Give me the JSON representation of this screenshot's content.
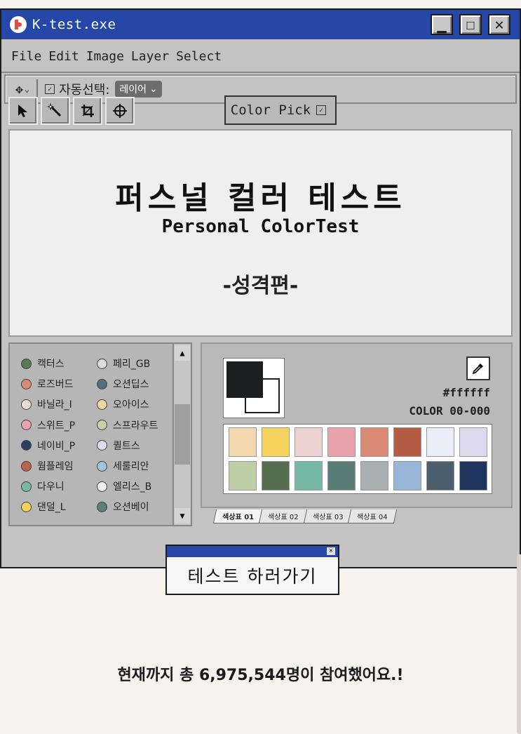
{
  "window": {
    "title": "K-test.exe",
    "controls": {
      "minimize": "▁",
      "maximize": "☐",
      "close": "✕"
    }
  },
  "menu": [
    "File",
    "Edit",
    "Image",
    "Layer",
    "Select"
  ],
  "options_bar": {
    "move_icon": "✥",
    "caret": "⌄",
    "auto_select_label": "자동선택:",
    "select_value": "레이어",
    "select_caret": "⌄"
  },
  "tools": [
    "arrow-tool",
    "magic-wand-tool",
    "crop-tool",
    "target-tool"
  ],
  "color_pick_label": "Color Pick",
  "canvas": {
    "title": "퍼스널 컬러 테스트",
    "subtitle": "Personal ColorTest",
    "edition": "-성격편-"
  },
  "types": [
    {
      "name": "캑터스",
      "color": "#5b7a52"
    },
    {
      "name": "로즈버드",
      "color": "#d98a72"
    },
    {
      "name": "바닐라_I",
      "color": "#f1dcd2"
    },
    {
      "name": "스위트_P",
      "color": "#e9a3ab"
    },
    {
      "name": "네이비_P",
      "color": "#2a3d66"
    },
    {
      "name": "웜플레임",
      "color": "#b9634d"
    },
    {
      "name": "다우니",
      "color": "#78b8a6"
    },
    {
      "name": "댄덜_L",
      "color": "#f4cf56"
    },
    {
      "name": "페리_GB",
      "color": "#dddddd"
    },
    {
      "name": "오션딥스",
      "color": "#556e7b"
    },
    {
      "name": "오아이스",
      "color": "#f3d6a2"
    },
    {
      "name": "스프라우트",
      "color": "#c2d4a4"
    },
    {
      "name": "퀼트스",
      "color": "#e0dcf0"
    },
    {
      "name": "세룰리안",
      "color": "#a6c3de"
    },
    {
      "name": "엘리스_B",
      "color": "#eef0f7"
    },
    {
      "name": "오션베이",
      "color": "#5d7f78"
    }
  ],
  "palette": {
    "foreground": "#1c1e1f",
    "background": "#ffffff",
    "hex": "#ffffff",
    "color_code": "COLOR 00-000",
    "swatches": [
      "#f3d8ae",
      "#f6d35e",
      "#ecd2d0",
      "#e7a2ab",
      "#d88a72",
      "#b35c43",
      "#e8edf7",
      "#ddd9ef",
      "#bfcfa5",
      "#556e4f",
      "#74b8a5",
      "#5b7d78",
      "#a9aeb1",
      "#98b6d8",
      "#4b5f6e",
      "#1f355e"
    ],
    "tabs": [
      "색상표 01",
      "색상표 02",
      "색상표 03",
      "색상표 04"
    ]
  },
  "cta_label": "테스트 하러가기",
  "participants_text": "현재까지 총 6,975,544명이 참여했어요.!"
}
